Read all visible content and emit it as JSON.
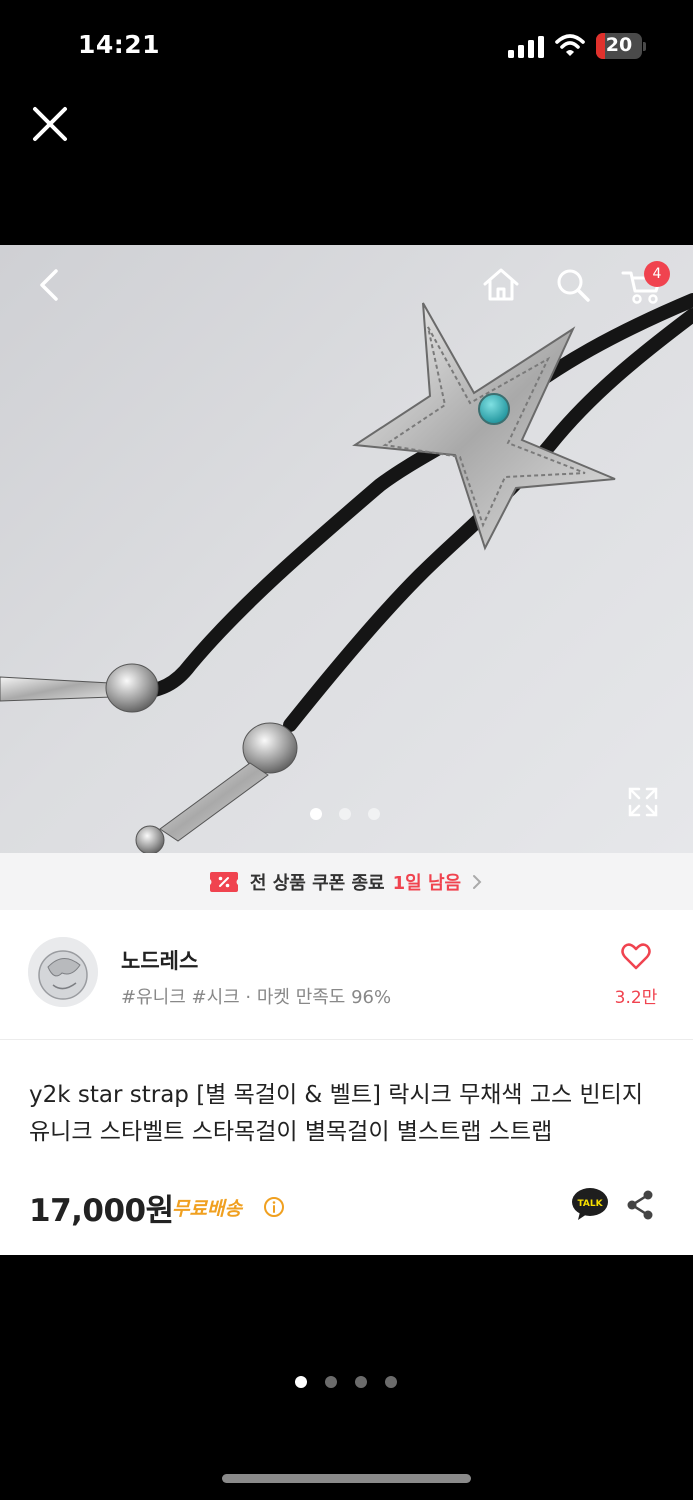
{
  "status_bar": {
    "time": "14:21",
    "battery_level": "20",
    "battery_fraction": 0.2,
    "battery_color": "#e0312c"
  },
  "top_nav": {
    "close_icon": "close-icon",
    "back_icon": "chevron-left-icon",
    "home_icon": "home-icon",
    "search_icon": "search-icon",
    "cart_icon": "cart-icon",
    "cart_badge": "4"
  },
  "gallery": {
    "image_count": 3,
    "active_index": 0
  },
  "coupon": {
    "text": "전 상품 쿠폰 종료",
    "remaining": "1일 남음"
  },
  "store": {
    "name": "노드레스",
    "meta": "#유니크 #시크 · 마켓 만족도 96%",
    "like_count": "3.2만"
  },
  "product": {
    "title": "y2k star strap [별 목걸이 & 벨트] 락시크 무채색 고스 빈티지 유니크 스타벨트 스타목걸이 별목걸이 별스트랩 스트랩",
    "price": "17,000원",
    "shipping": "무료배송"
  },
  "page_indicator": {
    "count": 4,
    "active_index": 0
  },
  "colors": {
    "accent": "#f0434f",
    "shipping": "#f0a020",
    "kakao": "#f9e000"
  }
}
